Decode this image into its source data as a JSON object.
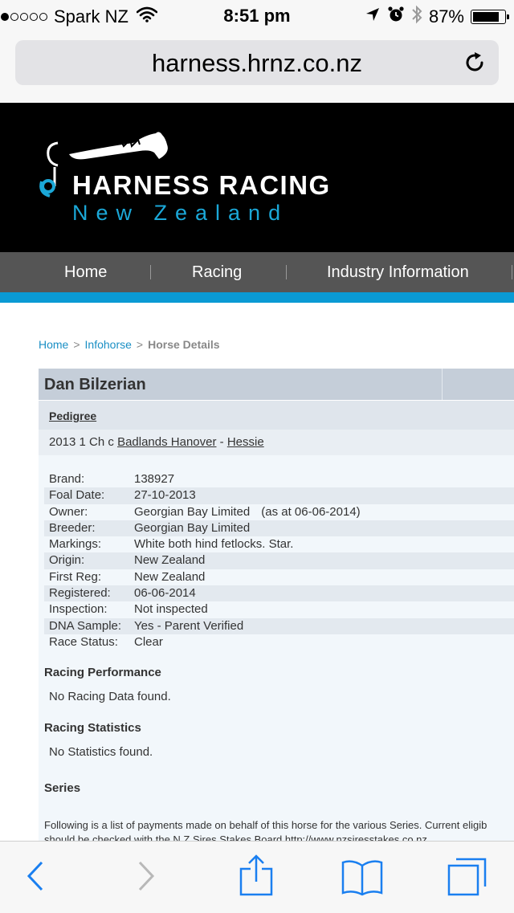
{
  "status_bar": {
    "carrier": "Spark NZ",
    "time": "8:51 pm",
    "battery_percent_text": "87%",
    "battery_level": 0.87,
    "signal_bars_filled": 1,
    "signal_bars_total": 5
  },
  "browser": {
    "url": "harness.hrnz.co.nz"
  },
  "site": {
    "logo_title": "HARNESS RACING",
    "logo_subtitle": "New Zealand",
    "accent_color": "#0a9ad4",
    "nav": [
      {
        "label": "Home"
      },
      {
        "label": "Racing"
      },
      {
        "label": "Industry Information"
      }
    ]
  },
  "breadcrumb": {
    "home": "Home",
    "infohorse": "Infohorse",
    "current": "Horse Details",
    "separator": ">"
  },
  "horse": {
    "name": "Dan Bilzerian",
    "pedigree_label": "Pedigree",
    "pedigree_prefix": "2013 1 Ch c",
    "sire": "Badlands Hanover",
    "pedigree_sep": "-",
    "dam": "Hessie",
    "details": [
      {
        "label": "Brand:",
        "value": "138927"
      },
      {
        "label": "Foal Date:",
        "value": "27-10-2013"
      },
      {
        "label": "Owner:",
        "value": "Georgian Bay Limited",
        "note": "(as at 06-06-2014)"
      },
      {
        "label": "Breeder:",
        "value": "Georgian Bay Limited"
      },
      {
        "label": "Markings:",
        "value": "White both hind fetlocks. Star."
      },
      {
        "label": "Origin:",
        "value": "New Zealand"
      },
      {
        "label": "First Reg:",
        "value": "New Zealand"
      },
      {
        "label": "Registered:",
        "value": "06-06-2014"
      },
      {
        "label": "Inspection:",
        "value": "Not inspected"
      },
      {
        "label": "DNA Sample:",
        "value": "Yes - Parent Verified"
      },
      {
        "label": "Race Status:",
        "value": "Clear"
      }
    ]
  },
  "sections": {
    "racing_performance": {
      "heading": "Racing Performance",
      "text": "No Racing Data found."
    },
    "racing_statistics": {
      "heading": "Racing Statistics",
      "text": "No Statistics found."
    },
    "series": {
      "heading": "Series",
      "text_line1": "Following is a list of payments made on behalf of this horse for the various Series. Current eligib",
      "text_line2": "should be checked with the N.Z Sires Stakes Board http://www.nzsiresstakes.co.nz"
    }
  }
}
